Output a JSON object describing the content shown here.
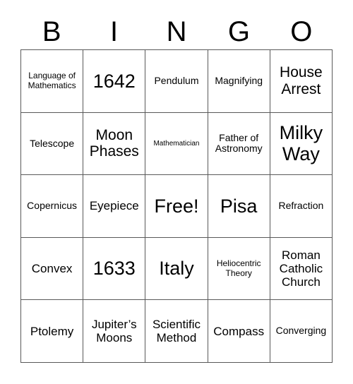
{
  "card": {
    "header_letters": [
      "B",
      "I",
      "N",
      "G",
      "O"
    ],
    "columns": 5,
    "rows": 5,
    "free_space_label": "Free!",
    "border_color": "#595959",
    "background_color": "#ffffff",
    "text_color": "#000000",
    "cells": [
      {
        "text": "Language of Mathematics",
        "size": "fs-s",
        "free": false
      },
      {
        "text": "1642",
        "size": "fs-xxl",
        "free": false
      },
      {
        "text": "Pendulum",
        "size": "fs-m",
        "free": false
      },
      {
        "text": "Magnifying",
        "size": "fs-m",
        "free": false
      },
      {
        "text": "House Arrest",
        "size": "fs-xl",
        "free": false
      },
      {
        "text": "Telescope",
        "size": "fs-m",
        "free": false
      },
      {
        "text": "Moon Phases",
        "size": "fs-xl",
        "free": false
      },
      {
        "text": "Mathematician",
        "size": "fs-xs",
        "free": false
      },
      {
        "text": "Father of Astronomy",
        "size": "fs-m",
        "free": false
      },
      {
        "text": "Milky Way",
        "size": "fs-xxl",
        "free": false
      },
      {
        "text": "Copernicus",
        "size": "fs-m",
        "free": false
      },
      {
        "text": "Eyepiece",
        "size": "fs-l",
        "free": false
      },
      {
        "text": "Free!",
        "size": "fs-xxl",
        "free": true
      },
      {
        "text": "Pisa",
        "size": "fs-xxl",
        "free": false
      },
      {
        "text": "Refraction",
        "size": "fs-m",
        "free": false
      },
      {
        "text": "Convex",
        "size": "fs-l",
        "free": false
      },
      {
        "text": "1633",
        "size": "fs-xxl",
        "free": false
      },
      {
        "text": "Italy",
        "size": "fs-xxl",
        "free": false
      },
      {
        "text": "Heliocentric Theory",
        "size": "fs-s",
        "free": false
      },
      {
        "text": "Roman Catholic Church",
        "size": "fs-l",
        "free": false
      },
      {
        "text": "Ptolemy",
        "size": "fs-l",
        "free": false
      },
      {
        "text": "Jupiter’s Moons",
        "size": "fs-l",
        "free": false
      },
      {
        "text": "Scientific Method",
        "size": "fs-l",
        "free": false
      },
      {
        "text": "Compass",
        "size": "fs-l",
        "free": false
      },
      {
        "text": "Converging",
        "size": "fs-m",
        "free": false
      }
    ]
  }
}
